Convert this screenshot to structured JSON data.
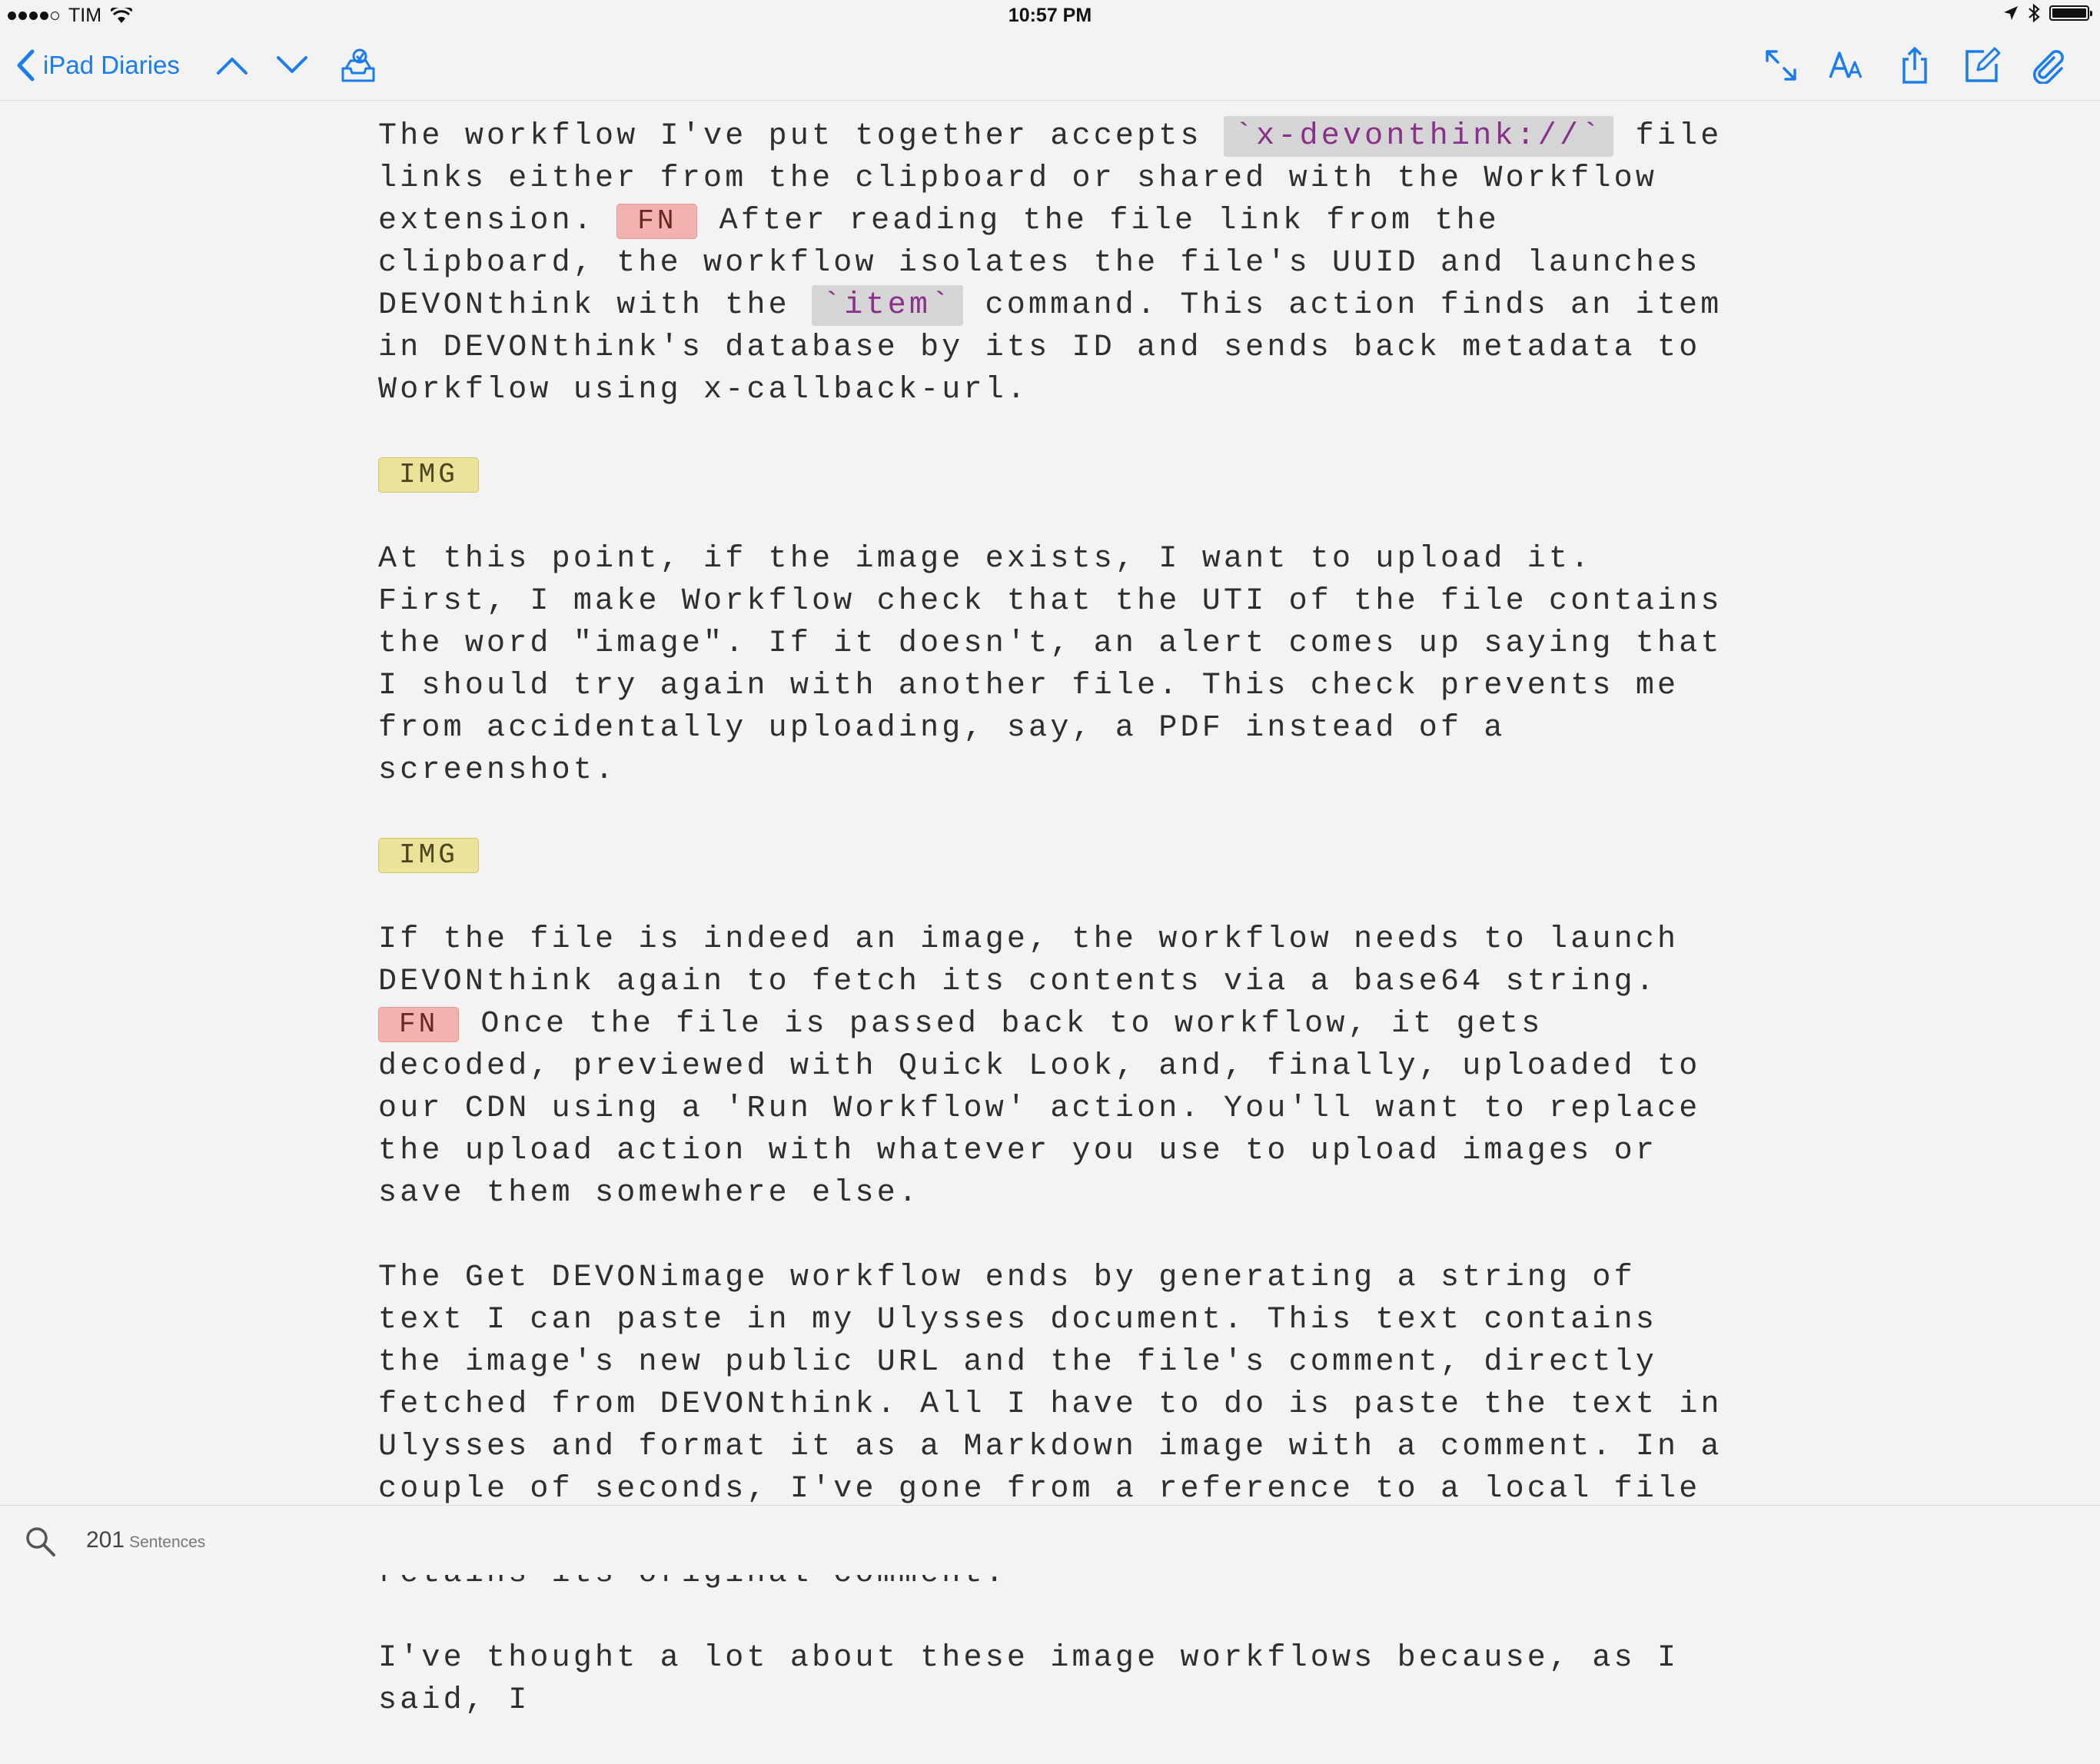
{
  "status": {
    "carrier": "TIM",
    "time": "10:57 PM",
    "battery_level": 0.95
  },
  "nav": {
    "back_label": "iPad Diaries",
    "icons": [
      "chevron-left-icon",
      "chevron-up-icon",
      "chevron-down-icon",
      "inbox-icon",
      "expand-icon",
      "font-size-icon",
      "share-icon",
      "compose-icon",
      "attachment-icon"
    ],
    "accent_color": "#1a7cf0"
  },
  "editor": {
    "p1": {
      "t1": "The workflow I've put together accepts ",
      "code1": "`x-devonthink://`",
      "t2": " file links either from the clipboard or shared with the Workflow extension. ",
      "fn": "FN",
      "t3": " After reading the file link from the clipboard, the workflow isolates the file's UUID and launches DEVONthink with the ",
      "code2": "`item`",
      "t4": " command. This action finds an item in DEVONthink's database by its ID and sends back metadata to Workflow using x-callback-url."
    },
    "img1": "IMG",
    "p2": "At this point, if the image exists, I want to upload it. First, I make Workflow check that the UTI of the file contains the word \"image\". If it doesn't, an alert comes up saying that I should try again with another file. This check prevents me from accidentally uploading, say, a PDF instead of a screenshot.",
    "img2": "IMG",
    "p3": {
      "t1": "If the file is indeed an image, the workflow needs to launch DEVONthink again to fetch its contents via a base64 string.",
      "fn": "FN",
      "t2": " Once the file is passed back to workflow, it gets decoded, previewed with Quick Look, and, finally, uploaded to our CDN using a 'Run Workflow' action. You'll want to replace the upload action with whatever you use to upload images or save them somewhere else."
    },
    "p4": "The Get DEVONimage workflow ends by generating a string of text I can paste in my Ulysses document. This text contains the image's new public URL and the file's comment, directly fetched from DEVONthink. All I have to do is paste the text in Ulysses and format it as a Markdown image with a comment. In a couple of seconds, I've gone from a reference to a local file stored in DEVONthink to an image uploaded to our CDN that retains its original comment.",
    "p5": "I've thought a lot about these image workflows because, as I said, I"
  },
  "footer": {
    "count": "201",
    "unit": "Sentences"
  }
}
